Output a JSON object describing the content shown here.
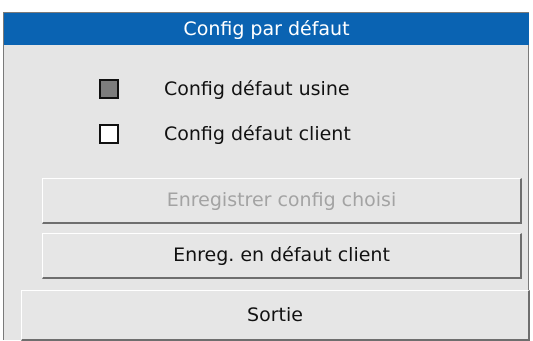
{
  "dialog": {
    "title": "Config par défaut"
  },
  "options": {
    "factory": {
      "label": "Config défaut usine",
      "checked": true
    },
    "client": {
      "label": "Config défaut client",
      "checked": false
    }
  },
  "buttons": {
    "save_selected": {
      "label": "Enregistrer config choisi",
      "enabled": false
    },
    "save_as_client_default": {
      "label": "Enreg. en défaut client",
      "enabled": true
    },
    "exit": {
      "label": "Sortie",
      "enabled": true
    }
  },
  "colors": {
    "title_bar": "#0a63b2",
    "dialog_background": "#e5e5e5",
    "checked_fill": "#7d7d7d",
    "disabled_text": "#a3a3a3"
  }
}
